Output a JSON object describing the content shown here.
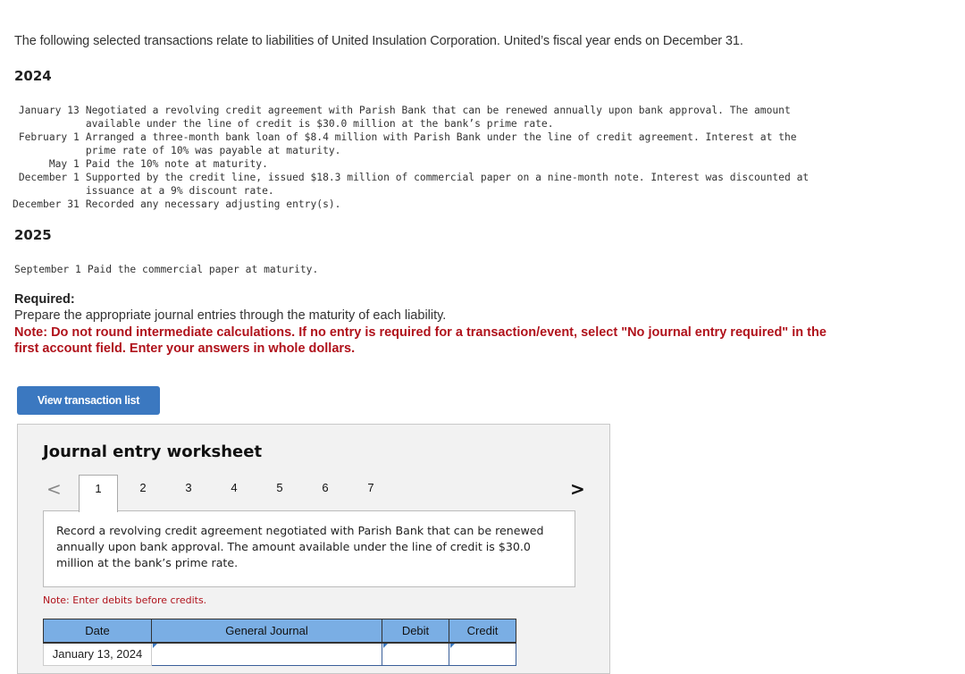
{
  "intro": "The following selected transactions relate to liabilities of United Insulation Corporation. United’s fiscal year ends on December 31.",
  "years": [
    "2024",
    "2025"
  ],
  "transactions_2024": [
    {
      "date": "January 13",
      "lines": [
        "Negotiated a revolving credit agreement with Parish Bank that can be renewed annually upon bank approval. The amount",
        "available under the line of credit is $30.0 million at the bank’s prime rate."
      ]
    },
    {
      "date": "February 1",
      "lines": [
        "Arranged a three-month bank loan of $8.4 million with Parish Bank under the line of credit agreement. Interest at the",
        "prime rate of 10% was payable at maturity."
      ]
    },
    {
      "date": "May 1",
      "lines": [
        "Paid the 10% note at maturity."
      ]
    },
    {
      "date": "December 1",
      "lines": [
        "Supported by the credit line, issued $18.3 million of commercial paper on a nine-month note. Interest was discounted at",
        "issuance at a 9% discount rate."
      ]
    },
    {
      "date": "December 31",
      "lines": [
        "Recorded any necessary adjusting entry(s)."
      ]
    }
  ],
  "transactions_2025": [
    {
      "date": "September 1",
      "lines": [
        "Paid the commercial paper at maturity."
      ]
    }
  ],
  "required": {
    "label": "Required:",
    "text": "Prepare the appropriate journal entries through the maturity of each liability.",
    "note": "Note: Do not round intermediate calculations. If no entry is required for a transaction/event, select \"No journal entry required\" in the first account field. Enter your answers in whole dollars."
  },
  "view_button": "View transaction list",
  "worksheet": {
    "title": "Journal entry worksheet",
    "prev_icon": "<",
    "next_icon": ">",
    "tabs": [
      "1",
      "2",
      "3",
      "4",
      "5",
      "6",
      "7"
    ],
    "active_tab": "1",
    "description": "Record a revolving credit agreement negotiated with Parish Bank that can be renewed annually upon bank approval. The amount available under the line of credit is $30.0 million at the bank’s prime rate.",
    "note": "Note: Enter debits before credits.",
    "table": {
      "headers": [
        "Date",
        "General Journal",
        "Debit",
        "Credit"
      ],
      "rows": [
        {
          "date": "January 13, 2024",
          "account": "",
          "debit": "",
          "credit": ""
        }
      ]
    }
  }
}
